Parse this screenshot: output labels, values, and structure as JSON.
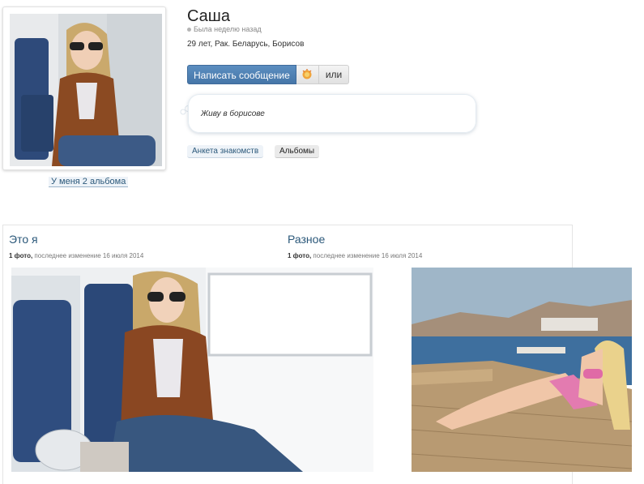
{
  "profile": {
    "name": "Саша",
    "last_seen": "Была неделю назад",
    "info": "29 лет, Рак. Беларусь, Борисов",
    "status_text": "Живу в борисове",
    "albums_link": "У меня 2 альбома"
  },
  "actions": {
    "message_label": "Написать сообщение",
    "gift_icon": "gift-icon",
    "or_label": "или"
  },
  "tabs": {
    "anketa": "Анкета знакомств",
    "albums": "Альбомы"
  },
  "albums": [
    {
      "title": "Это я",
      "count": "1 фото,",
      "updated": "последнее изменение 16 июля 2014"
    },
    {
      "title": "Разное",
      "count": "1 фото,",
      "updated": "последнее изменение 16 июля 2014"
    }
  ],
  "colors": {
    "accent": "#4676a8",
    "link": "#2b587a"
  }
}
